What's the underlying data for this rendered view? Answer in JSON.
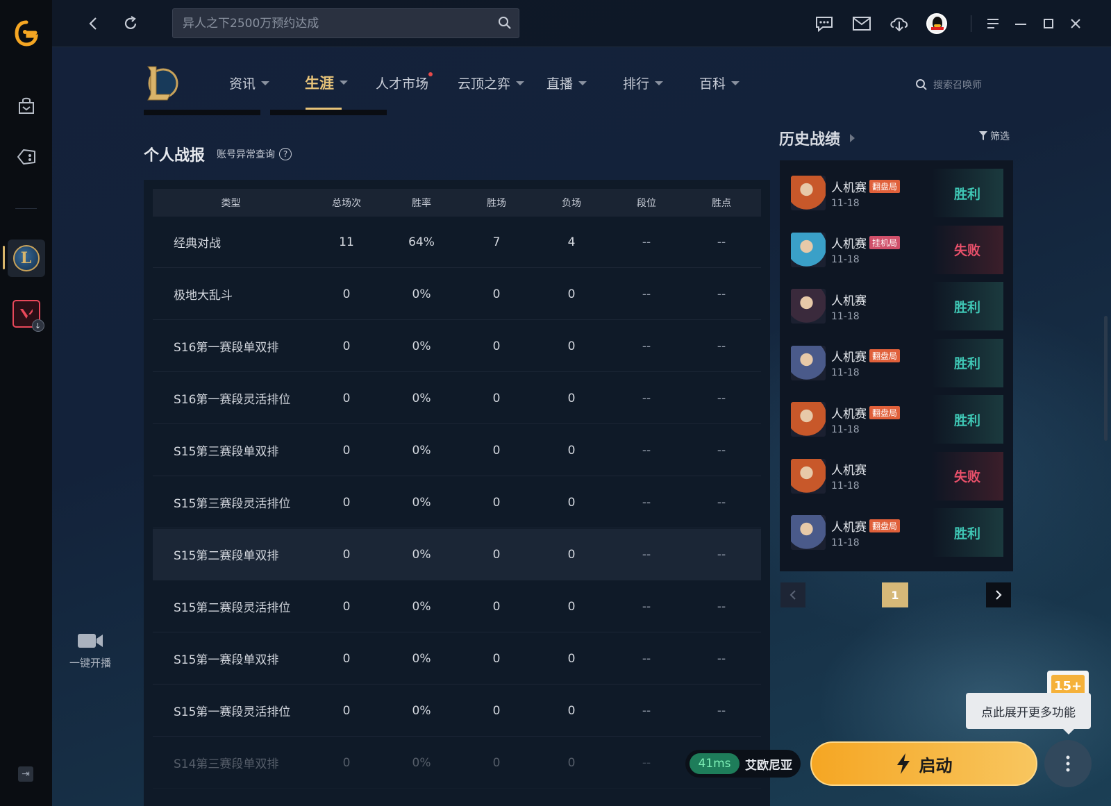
{
  "search": {
    "placeholder": "异人之下2500万预约达成"
  },
  "game_nav": {
    "items": [
      {
        "label": "资讯"
      },
      {
        "label": "生涯"
      },
      {
        "label": "人才市场"
      },
      {
        "label": "云顶之弈"
      },
      {
        "label": "直播"
      },
      {
        "label": "排行"
      },
      {
        "label": "百科"
      }
    ],
    "active": "生涯",
    "summoner_search_placeholder": "搜索召唤师"
  },
  "sidebar": {
    "live_label": "一键开播"
  },
  "stats": {
    "title": "个人战报",
    "account_check": "账号异常查询",
    "columns": [
      "类型",
      "总场次",
      "胜率",
      "胜场",
      "负场",
      "段位",
      "胜点"
    ],
    "rows": [
      [
        "经典对战",
        "11",
        "64%",
        "7",
        "4",
        "--",
        "--"
      ],
      [
        "极地大乱斗",
        "0",
        "0%",
        "0",
        "0",
        "--",
        "--"
      ],
      [
        "S16第一赛段单双排",
        "0",
        "0%",
        "0",
        "0",
        "--",
        "--"
      ],
      [
        "S16第一赛段灵活排位",
        "0",
        "0%",
        "0",
        "0",
        "--",
        "--"
      ],
      [
        "S15第三赛段单双排",
        "0",
        "0%",
        "0",
        "0",
        "--",
        "--"
      ],
      [
        "S15第三赛段灵活排位",
        "0",
        "0%",
        "0",
        "0",
        "--",
        "--"
      ],
      [
        "S15第二赛段单双排",
        "0",
        "0%",
        "0",
        "0",
        "--",
        "--"
      ],
      [
        "S15第二赛段灵活排位",
        "0",
        "0%",
        "0",
        "0",
        "--",
        "--"
      ],
      [
        "S15第一赛段单双排",
        "0",
        "0%",
        "0",
        "0",
        "--",
        "--"
      ],
      [
        "S15第一赛段灵活排位",
        "0",
        "0%",
        "0",
        "0",
        "--",
        "--"
      ],
      [
        "S14第三赛段单双排",
        "0",
        "0%",
        "0",
        "0",
        "--",
        "--"
      ]
    ]
  },
  "history": {
    "title": "历史战绩",
    "filter_label": "筛选",
    "matches": [
      {
        "mode": "人机赛",
        "tag": "翻盘局",
        "date": "11-18",
        "result": "胜利",
        "win": true,
        "champ_color": "#c8582a"
      },
      {
        "mode": "人机赛",
        "tag": "挂机局",
        "date": "11-18",
        "result": "失败",
        "win": false,
        "champ_color": "#3aa0c8"
      },
      {
        "mode": "人机赛",
        "tag": "",
        "date": "11-18",
        "result": "胜利",
        "win": true,
        "champ_color": "#3a2a3c"
      },
      {
        "mode": "人机赛",
        "tag": "翻盘局",
        "date": "11-18",
        "result": "胜利",
        "win": true,
        "champ_color": "#4a5a8a"
      },
      {
        "mode": "人机赛",
        "tag": "翻盘局",
        "date": "11-18",
        "result": "胜利",
        "win": true,
        "champ_color": "#c8582a"
      },
      {
        "mode": "人机赛",
        "tag": "",
        "date": "11-18",
        "result": "失败",
        "win": false,
        "champ_color": "#c8582a"
      },
      {
        "mode": "人机赛",
        "tag": "翻盘局",
        "date": "11-18",
        "result": "胜利",
        "win": true,
        "champ_color": "#4a5a8a"
      }
    ],
    "page": "1"
  },
  "badge": "15+",
  "tooltip": "点此展开更多功能",
  "server": {
    "ping": "41ms",
    "name": "艾欧尼亚"
  },
  "launch_label": "启动",
  "colors": {
    "accent_gold": "#e8c47a",
    "win": "#3fc7b5",
    "lose": "#e8506a",
    "launch": "#f5a623"
  }
}
